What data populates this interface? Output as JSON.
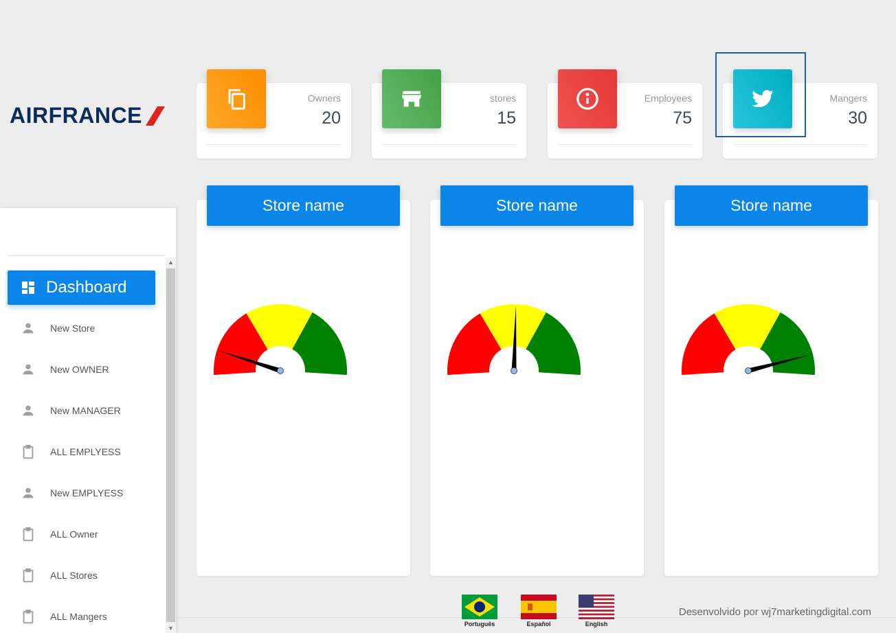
{
  "brand": {
    "name": "AIRFRANCE",
    "colors": {
      "navy": "#0c2a5b",
      "red": "#e2231a"
    }
  },
  "stats": [
    {
      "label": "Owners",
      "value": "20",
      "icon": "copy-icon",
      "color": "#fb8c00"
    },
    {
      "label": "stores",
      "value": "15",
      "icon": "store-icon",
      "color": "#4caf50"
    },
    {
      "label": "Employees",
      "value": "75",
      "icon": "info-icon",
      "color": "#e53935"
    },
    {
      "label": "Mangers",
      "value": "30",
      "icon": "twitter-icon",
      "color": "#00acc1"
    }
  ],
  "stores": [
    {
      "name": "Store name",
      "gauge_value": 0.1
    },
    {
      "name": "Store name",
      "gauge_value": 0.51
    },
    {
      "name": "Store name",
      "gauge_value": 0.92
    }
  ],
  "gauge_colors": {
    "low": "#ff0000",
    "mid": "#ffff00",
    "high": "#008000"
  },
  "sidebar": {
    "active": {
      "label": "Dashboard",
      "icon": "dashboard-icon"
    },
    "items": [
      {
        "label": "New Store",
        "icon": "person-icon"
      },
      {
        "label": "New OWNER",
        "icon": "person-icon"
      },
      {
        "label": "New MANAGER",
        "icon": "person-icon"
      },
      {
        "label": "ALL EMPLYESS",
        "icon": "clipboard-icon"
      },
      {
        "label": "New EMPLYESS",
        "icon": "person-icon"
      },
      {
        "label": "ALL Owner",
        "icon": "clipboard-icon"
      },
      {
        "label": "ALL Stores",
        "icon": "clipboard-icon"
      },
      {
        "label": "ALL Mangers",
        "icon": "clipboard-icon"
      }
    ]
  },
  "languages": [
    {
      "label": "Português",
      "flag": "brazil-flag-icon"
    },
    {
      "label": "Español",
      "flag": "spain-flag-icon"
    },
    {
      "label": "English",
      "flag": "usa-flag-icon"
    }
  ],
  "footer": {
    "credit": "Desenvolvido por wj7marketingdigital.com"
  }
}
